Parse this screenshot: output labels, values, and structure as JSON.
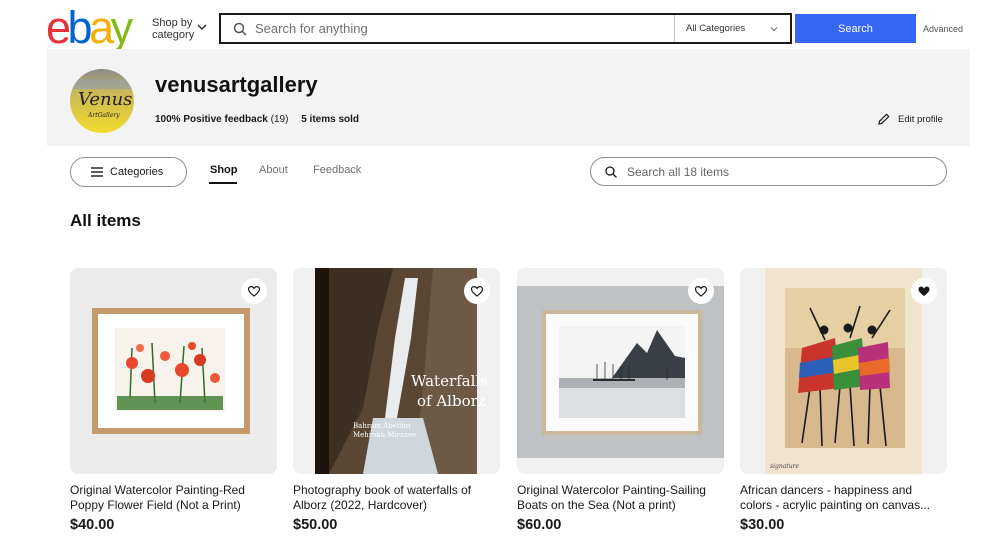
{
  "header": {
    "logo_letters": [
      "e",
      "b",
      "a",
      "y"
    ],
    "logo_colors": [
      "#e53238",
      "#0064d2",
      "#f5af02",
      "#86b817"
    ],
    "shop_by_line1": "Shop by",
    "shop_by_line2": "category",
    "search_placeholder": "Search for anything",
    "category_select": "All Categories",
    "search_button": "Search",
    "advanced_link": "Advanced",
    "accent": "#3665f3"
  },
  "seller": {
    "name": "venusartgallery",
    "feedback_percent": "100% Positive feedback",
    "feedback_count": "(19)",
    "items_sold": "5 items sold",
    "edit_profile": "Edit profile",
    "avatar_text": "Venus",
    "avatar_subtext": "ArtGallery"
  },
  "nav": {
    "categories_button": "Categories",
    "tabs": [
      {
        "label": "Shop",
        "active": true
      },
      {
        "label": "About",
        "active": false
      },
      {
        "label": "Feedback",
        "active": false
      }
    ],
    "store_search_placeholder": "Search all 18 items"
  },
  "section_title": "All items",
  "products": [
    {
      "title": "Original Watercolor Painting-Red Poppy Flower Field (Not a Print)",
      "price": "$40.00",
      "watched": false,
      "icon": "poppy-painting-image"
    },
    {
      "title": "Photography book of waterfalls of Alborz (2022, Hardcover)",
      "price": "$50.00",
      "watched": false,
      "icon": "waterfall-book-image",
      "book_title": "Waterfalls of Alborz",
      "book_author": "Bahram Abedini / Mehrokh Mirzaee"
    },
    {
      "title": "Original Watercolor Painting-Sailing Boats on the Sea (Not a print)",
      "price": "$60.00",
      "watched": false,
      "icon": "sailboat-painting-image"
    },
    {
      "title": "African dancers - happiness and colors - acrylic painting on canvas...",
      "price": "$30.00",
      "watched": true,
      "icon": "dancers-painting-image"
    }
  ]
}
